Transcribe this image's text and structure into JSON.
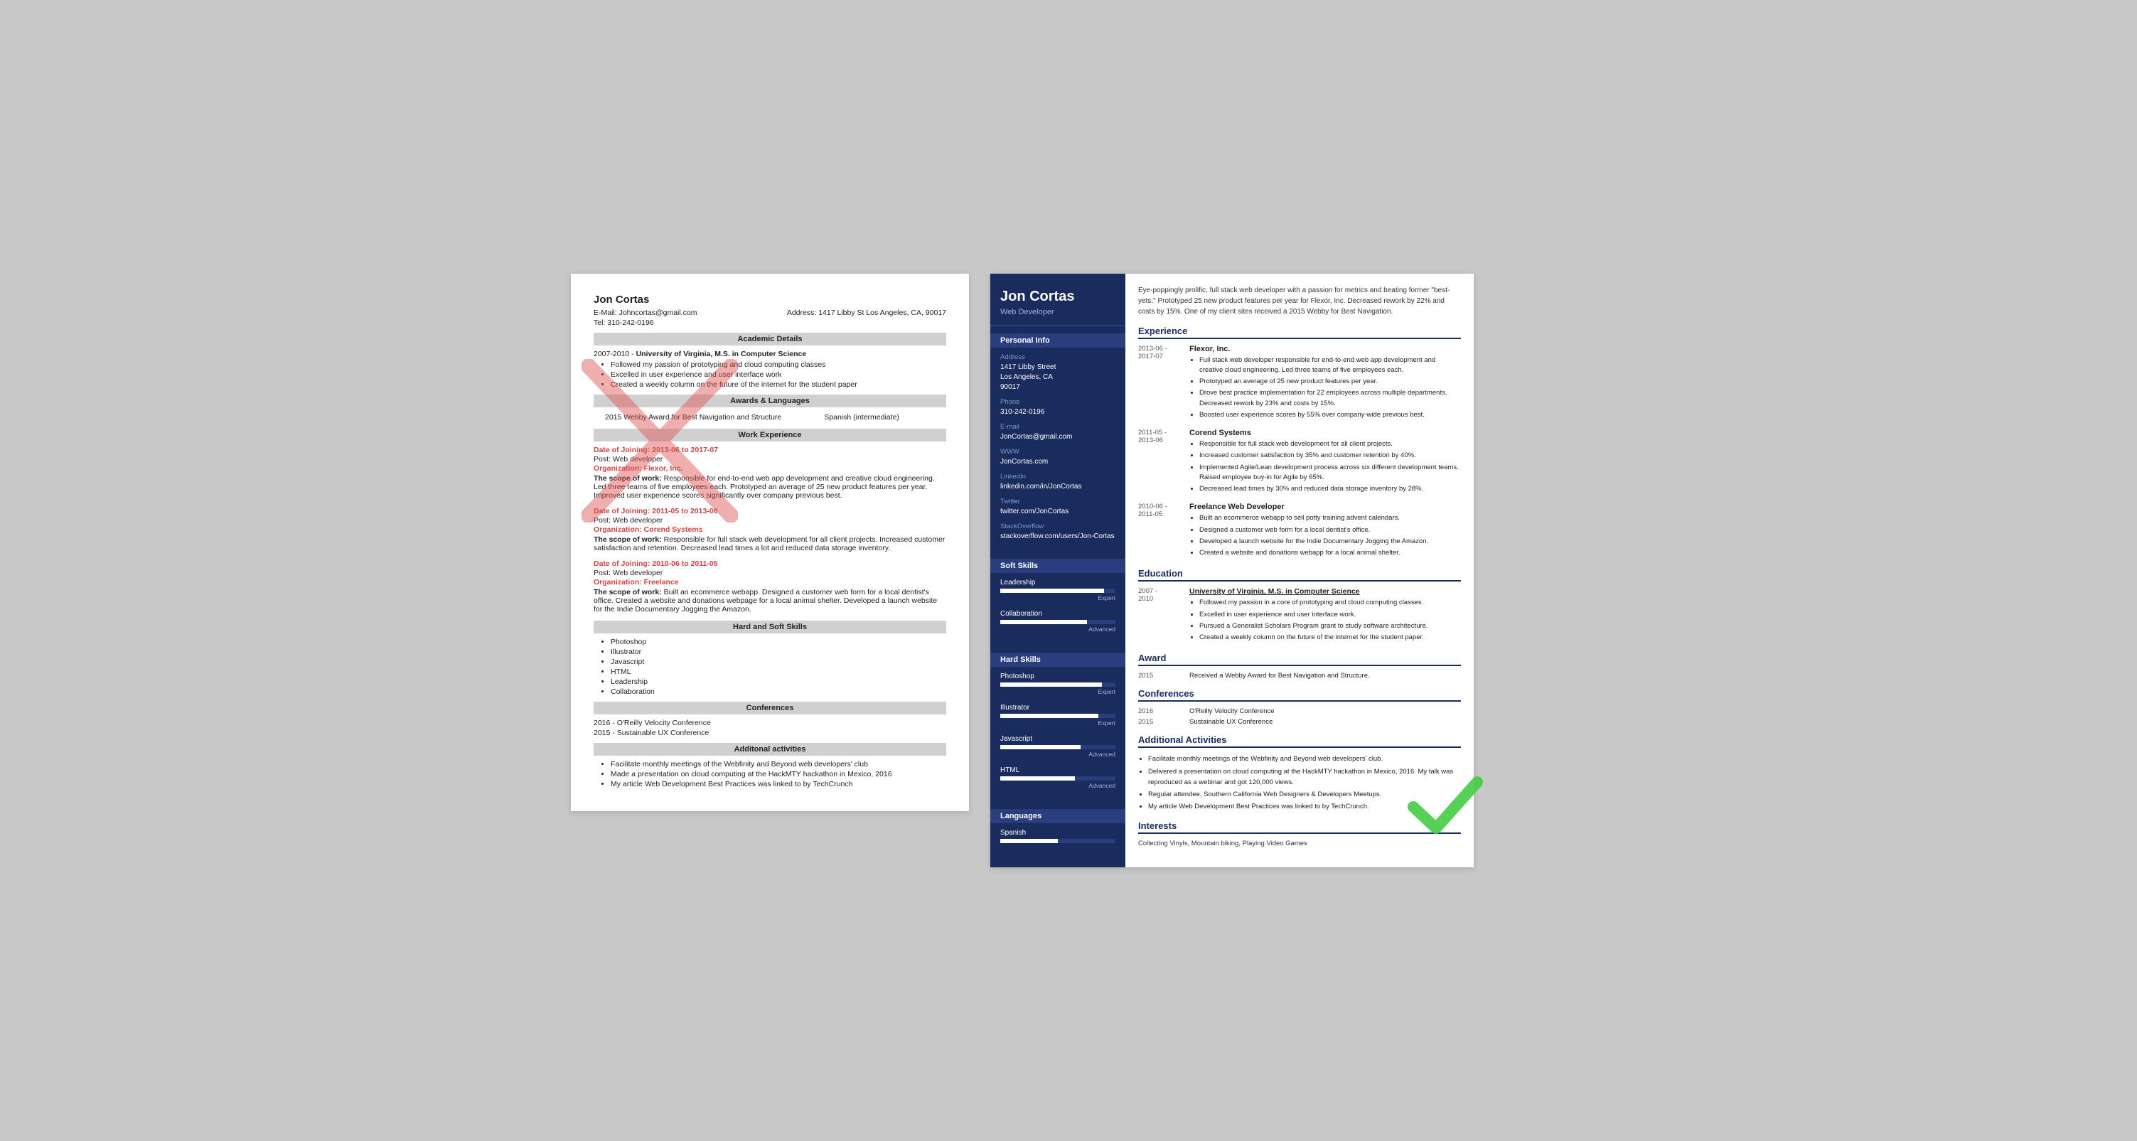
{
  "leftResume": {
    "name": "Jon Cortas",
    "email": "E-Mail: Johncortas@gmail.com",
    "address": "Address: 1417 Libby St Los Angeles, CA, 90017",
    "phone": "Tel: 310-242-0196",
    "sections": {
      "academic": "Academic Details",
      "awards": "Awards & Languages",
      "workExp": "Work Experience",
      "hardSoft": "Hard and Soft Skills",
      "conferences": "Conferences",
      "additional": "Additonal activities"
    },
    "academic": {
      "years": "2007-2010 -",
      "degree": "University of Virginia, M.S. in Computer Science",
      "bullets": [
        "Followed my passion of prototyping and cloud computing classes",
        "Excelled in user experience and user interface work",
        "Created a weekly column on the future of the internet for the student paper"
      ]
    },
    "awards": {
      "left": "2015 Webby Award for Best Navigation and Structure",
      "right": "Spanish (intermediate)"
    },
    "workEntries": [
      {
        "dateLabel": "Date of Joining:",
        "dateValue": "2013-06 to 2017-07",
        "postLabel": "Post:",
        "postValue": "Web developer",
        "orgLabel": "Organization:",
        "orgValue": "Flexor, Inc.",
        "scopeLabel": "The scope of work:",
        "scopeText": "Responsible for end-to-end web app development and creative cloud engineering. Led three teams of five employees each. Prototyped an average of 25 new product features per year. Improved user experience scores significantly over company previous best."
      },
      {
        "dateLabel": "Date of Joining:",
        "dateValue": "2011-05 to 2013-06",
        "postLabel": "Post:",
        "postValue": "Web developer",
        "orgLabel": "Organization:",
        "orgValue": "Corend Systems",
        "scopeLabel": "The scope of work:",
        "scopeText": "Responsible for full stack web development for all client projects. Increased customer satisfaction and retention. Decreased lead times a lot and reduced data storage inventory."
      },
      {
        "dateLabel": "Date of Joining:",
        "dateValue": "2010-06 to 2011-05",
        "postLabel": "Post:",
        "postValue": "Web developer",
        "orgLabel": "Organization:",
        "orgValue": "Freelance",
        "scopeLabel": "The scope of work:",
        "scopeText": "Built an ecommerce webapp. Designed a customer web form for a local dentist's office. Created a website and donations webpage for a local animal shelter. Developed a launch website for the Indie Documentary Jogging the Amazon."
      }
    ],
    "skills": [
      "Photoshop",
      "Illustrator",
      "Javascript",
      "HTML",
      "Leadership",
      "Collaboration"
    ],
    "conferences": [
      "2016 - O'Reilly Velocity Conference",
      "2015 - Sustainable UX Conference"
    ],
    "additionalActivities": [
      "Facilitate monthly meetings of the Webfinity and Beyond web developers' club",
      "Made a presentation on cloud computing at the HackMTY hackathon in Mexico, 2016",
      "My article Web Development Best Practices was linked to by TechCrunch"
    ]
  },
  "rightResume": {
    "name": "Jon Cortas",
    "title": "Web Developer",
    "summary": "Eye-poppingly prolific, full stack web developer with a passion for metrics and beating former \"best-yets.\" Prototyped 25 new product features per year for Flexor, Inc. Decreased rework by 22% and costs by 15%. One of my client sites received a 2015 Webby for Best Navigation.",
    "sidebar": {
      "personalInfoTitle": "Personal Info",
      "address": {
        "label": "Address",
        "value": "1417 Libby Street\nLos Angeles, CA\n90017"
      },
      "phone": {
        "label": "Phone",
        "value": "310-242-0196"
      },
      "email": {
        "label": "E-mail",
        "value": "JonCortas@gmail.com"
      },
      "www": {
        "label": "WWW",
        "value": "JonCortas.com"
      },
      "linkedin": {
        "label": "LinkedIn",
        "value": "linkedin.com/in/JonCortas"
      },
      "twitter": {
        "label": "Twitter",
        "value": "twitter.com/JonCortas"
      },
      "stackoverflow": {
        "label": "StackOverflow",
        "value": "stackoverflow.com/users/Jon-Cortas"
      },
      "softSkillsTitle": "Soft Skills",
      "softSkills": [
        {
          "name": "Leadership",
          "percent": 90,
          "level": "Expert"
        },
        {
          "name": "Collaboration",
          "percent": 75,
          "level": "Advanced"
        }
      ],
      "hardSkillsTitle": "Hard Skills",
      "hardSkills": [
        {
          "name": "Photoshop",
          "percent": 88,
          "level": "Expert"
        },
        {
          "name": "Illustrator",
          "percent": 85,
          "level": "Expert"
        },
        {
          "name": "Javascript",
          "percent": 70,
          "level": "Advanced"
        },
        {
          "name": "HTML",
          "percent": 65,
          "level": "Advanced"
        }
      ],
      "languagesTitle": "Languages",
      "languages": [
        {
          "name": "Spanish",
          "percent": 50,
          "level": ""
        }
      ]
    },
    "experience": {
      "title": "Experience",
      "entries": [
        {
          "dateStart": "2013-06 -",
          "dateEnd": "2017-07",
          "company": "Flexor, Inc.",
          "bullets": [
            "Full stack web developer responsible for end-to-end web app development and creative cloud engineering. Led three teams of five employees each.",
            "Prototyped an average of 25 new product features per year.",
            "Drove best practice implementation for 22 employees across multiple departments. Decreased rework by 23% and costs by 15%.",
            "Boosted user experience scores by 55% over company-wide previous best."
          ]
        },
        {
          "dateStart": "2011-05 -",
          "dateEnd": "2013-06",
          "company": "Corend Systems",
          "bullets": [
            "Responsible for full stack web development for all client projects.",
            "Increased customer satisfaction by 35% and customer retention by 40%.",
            "Implemented Agile/Lean development process across six different development teams. Raised employee buy-in for Agile by 65%.",
            "Decreased lead times by 30% and reduced data storage inventory by 28%."
          ]
        },
        {
          "dateStart": "2010-06 -",
          "dateEnd": "2011-05",
          "company": "Freelance Web Developer",
          "bullets": [
            "Built an ecommerce webapp to sell potty training advent calendars.",
            "Designed a customer web form for a local dentist's office.",
            "Developed a launch website for the Indie Documentary Jogging the Amazon.",
            "Created a website and donations webapp for a local animal shelter."
          ]
        }
      ]
    },
    "education": {
      "title": "Education",
      "entries": [
        {
          "dateStart": "2007 -",
          "dateEnd": "2010",
          "school": "University of Virginia, M.S. in Computer Science",
          "bullets": [
            "Followed my passion in a core of prototyping and cloud computing classes.",
            "Excelled in user experience and user interface work.",
            "Pursued a Generalist Scholars Program grant to study software architecture.",
            "Created a weekly column on the future of the internet for the student paper."
          ]
        }
      ]
    },
    "award": {
      "title": "Award",
      "year": "2015",
      "text": "Received a Webby Award for Best Navigation and Structure."
    },
    "conferences": {
      "title": "Conferences",
      "entries": [
        {
          "year": "2016",
          "name": "O'Reilly Velocity Conference"
        },
        {
          "year": "2015",
          "name": "Sustainable UX Conference"
        }
      ]
    },
    "additionalActivities": {
      "title": "Additional Activities",
      "bullets": [
        "Facilitate monthly meetings of the Webfinity and Beyond web developers' club.",
        "Delivered a presentation on cloud computing at the HackMTY hackathon in Mexico, 2016. My talk was reproduced as a webinar and got 120,000 views.",
        "Regular attendee, Southern California Web Designers & Developers Meetups.",
        "My article Web Development Best Practices was linked to by TechCrunch."
      ]
    },
    "interests": {
      "title": "Interests",
      "text": "Collecting Vinyls, Mountain biking, Playing Video Games"
    }
  }
}
